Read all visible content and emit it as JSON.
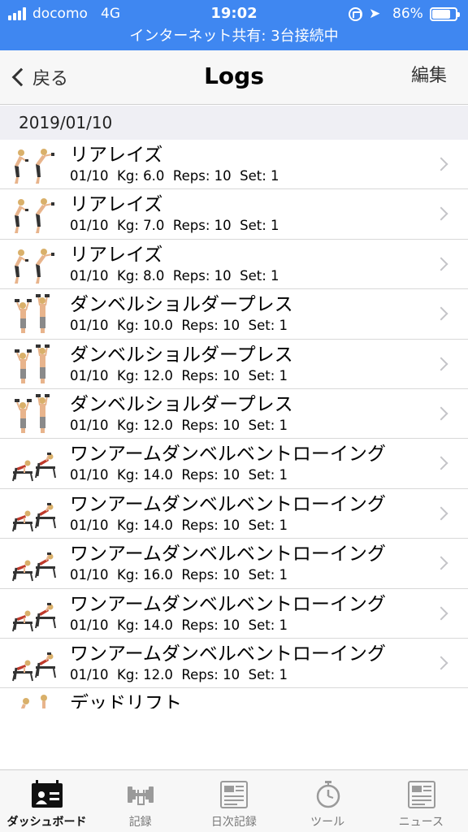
{
  "status_bar": {
    "carrier": "docomo",
    "network": "4G",
    "time": "19:02",
    "battery_percent": "86%",
    "battery_level": 0.86,
    "hotspot_text": "インターネット共有: 3台接続中",
    "background_color": "#3f87f1"
  },
  "nav": {
    "back_label": "戻る",
    "title": "Logs",
    "edit_label": "編集"
  },
  "section": {
    "date": "2019/01/10"
  },
  "logs": [
    {
      "title": "リアレイズ",
      "detail": "01/10  Kg: 6.0  Reps: 10  Set: 1",
      "icon": "rear-raise-figure"
    },
    {
      "title": "リアレイズ",
      "detail": "01/10  Kg: 7.0  Reps: 10  Set: 1",
      "icon": "rear-raise-figure"
    },
    {
      "title": "リアレイズ",
      "detail": "01/10  Kg: 8.0  Reps: 10  Set: 1",
      "icon": "rear-raise-figure"
    },
    {
      "title": "ダンベルショルダープレス",
      "detail": "01/10  Kg: 10.0  Reps: 10  Set: 1",
      "icon": "shoulder-press-figure"
    },
    {
      "title": "ダンベルショルダープレス",
      "detail": "01/10  Kg: 12.0  Reps: 10  Set: 1",
      "icon": "shoulder-press-figure"
    },
    {
      "title": "ダンベルショルダープレス",
      "detail": "01/10  Kg: 12.0  Reps: 10  Set: 1",
      "icon": "shoulder-press-figure"
    },
    {
      "title": "ワンアームダンベルベントローイング",
      "detail": "01/10  Kg: 14.0  Reps: 10  Set: 1",
      "icon": "bent-row-figure"
    },
    {
      "title": "ワンアームダンベルベントローイング",
      "detail": "01/10  Kg: 14.0  Reps: 10  Set: 1",
      "icon": "bent-row-figure"
    },
    {
      "title": "ワンアームダンベルベントローイング",
      "detail": "01/10  Kg: 16.0  Reps: 10  Set: 1",
      "icon": "bent-row-figure"
    },
    {
      "title": "ワンアームダンベルベントローイング",
      "detail": "01/10  Kg: 14.0  Reps: 10  Set: 1",
      "icon": "bent-row-figure"
    },
    {
      "title": "ワンアームダンベルベントローイング",
      "detail": "01/10  Kg: 12.0  Reps: 10  Set: 1",
      "icon": "bent-row-figure"
    },
    {
      "title": "デッドリフト",
      "detail": "",
      "icon": "deadlift-figure"
    }
  ],
  "tabs": [
    {
      "label": "ダッシュボード",
      "icon": "dashboard-icon",
      "active": true
    },
    {
      "label": "記録",
      "icon": "dumbbell-icon",
      "active": false
    },
    {
      "label": "日次記録",
      "icon": "document-icon",
      "active": false
    },
    {
      "label": "ツール",
      "icon": "stopwatch-icon",
      "active": false
    },
    {
      "label": "ニュース",
      "icon": "news-icon",
      "active": false
    }
  ]
}
